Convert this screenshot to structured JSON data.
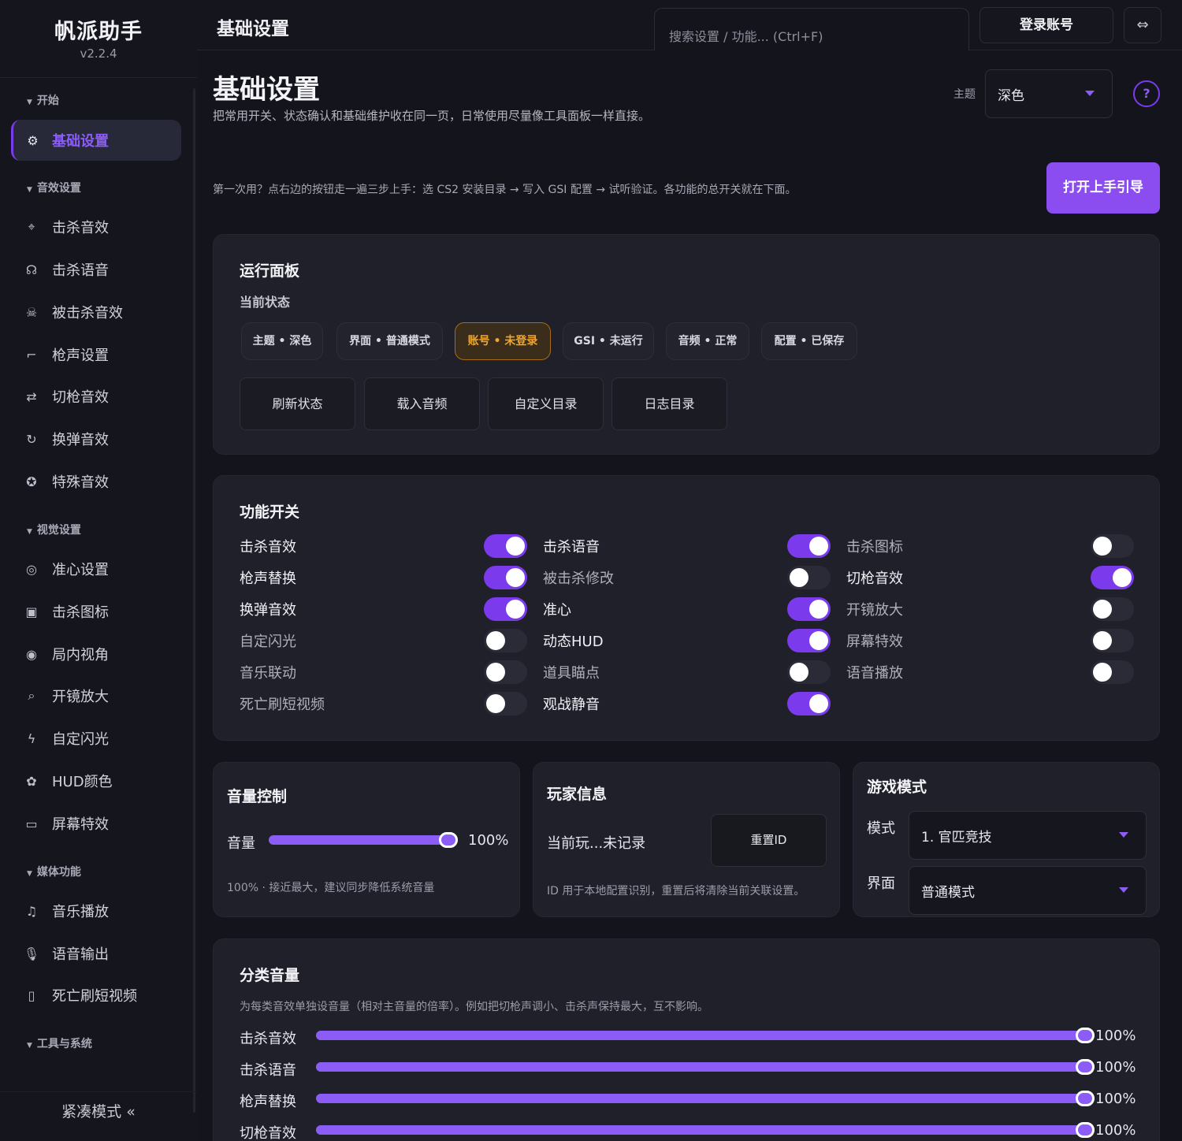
{
  "app": {
    "name": "帆派助手",
    "version": "v2.2.4"
  },
  "sidebar": {
    "sections": [
      {
        "label": "开始"
      },
      {
        "label": "音效设置"
      },
      {
        "label": "视觉设置"
      },
      {
        "label": "媒体功能"
      },
      {
        "label": "工具与系统"
      }
    ],
    "items": [
      {
        "label": "基础设置",
        "icon": "gear-icon"
      },
      {
        "label": "击杀音效",
        "icon": "crosshair-icon"
      },
      {
        "label": "击杀语音",
        "icon": "voice-icon"
      },
      {
        "label": "被击杀音效",
        "icon": "skull-icon"
      },
      {
        "label": "枪声设置",
        "icon": "gun-icon"
      },
      {
        "label": "切枪音效",
        "icon": "swap-icon"
      },
      {
        "label": "换弹音效",
        "icon": "reload-icon"
      },
      {
        "label": "特殊音效",
        "icon": "star-icon"
      },
      {
        "label": "准心设置",
        "icon": "target-icon"
      },
      {
        "label": "击杀图标",
        "icon": "image-icon"
      },
      {
        "label": "局内视角",
        "icon": "eye-icon"
      },
      {
        "label": "开镜放大",
        "icon": "zoom-icon"
      },
      {
        "label": "自定闪光",
        "icon": "flash-icon"
      },
      {
        "label": "HUD颜色",
        "icon": "palette-icon"
      },
      {
        "label": "屏幕特效",
        "icon": "monitor-icon"
      },
      {
        "label": "音乐播放",
        "icon": "music-icon"
      },
      {
        "label": "语音输出",
        "icon": "mic-icon"
      },
      {
        "label": "死亡刷短视频",
        "icon": "phone-icon"
      }
    ],
    "compact_label": "紧凑模式",
    "compact_icon": "«"
  },
  "topbar": {
    "title": "基础设置",
    "search_placeholder": "搜索设置 / 功能... (Ctrl+F)",
    "login_label": "登录账号",
    "swap_icon": "⇔"
  },
  "page": {
    "title": "基础设置",
    "subtitle": "把常用开关、状态确认和基础维护收在同一页，日常使用尽量像工具面板一样直接。",
    "theme_label": "主题",
    "theme_value": "深色",
    "help": "?",
    "guide_text": "第一次用？点右边的按钮走一遍三步上手：选 CS2 安装目录 → 写入 GSI 配置 → 试听验证。各功能的总开关就在下面。",
    "guide_button": "打开上手引导"
  },
  "run_panel": {
    "title": "运行面板",
    "status_title": "当前状态",
    "pills": [
      "主题 • 深色",
      "界面 • 普通模式",
      "账号 • 未登录",
      "GSI • 未运行",
      "音频 • 正常",
      "配置 • 已保存"
    ],
    "actions": [
      "刷新状态",
      "载入音频",
      "自定义目录",
      "日志目录"
    ],
    "accent_warn": "#f5a524"
  },
  "features": {
    "title": "功能开关",
    "accent": "#7c3aed",
    "toggles": [
      {
        "label": "击杀音效",
        "on": true
      },
      {
        "label": "击杀语音",
        "on": true
      },
      {
        "label": "击杀图标",
        "on": false
      },
      {
        "label": "枪声替换",
        "on": true
      },
      {
        "label": "被击杀修改",
        "on": false
      },
      {
        "label": "切枪音效",
        "on": true
      },
      {
        "label": "换弹音效",
        "on": true
      },
      {
        "label": "准心",
        "on": true
      },
      {
        "label": "开镜放大",
        "on": false
      },
      {
        "label": "自定闪光",
        "on": false
      },
      {
        "label": "动态HUD",
        "on": true
      },
      {
        "label": "屏幕特效",
        "on": false
      },
      {
        "label": "音乐联动",
        "on": false
      },
      {
        "label": "道具瞄点",
        "on": false
      },
      {
        "label": "语音播放",
        "on": false
      },
      {
        "label": "死亡刷短视频",
        "on": false
      },
      {
        "label": "观战静音",
        "on": true
      }
    ]
  },
  "volume": {
    "title": "音量控制",
    "label": "音量",
    "value_text": "100%",
    "value": 1.0,
    "hint": "100% · 接近最大，建议同步降低系统音量"
  },
  "player": {
    "title": "玩家信息",
    "current": "当前玩...未记录",
    "reset_button": "重置ID",
    "hint": "ID 用于本地配置识别，重置后将清除当前关联设置。"
  },
  "game_mode": {
    "title": "游戏模式",
    "mode_label": "模式",
    "mode_value": "1. 官匹竞技",
    "ui_label": "界面",
    "ui_value": "普通模式"
  },
  "category_volume": {
    "title": "分类音量",
    "hint": "为每类音效单独设音量（相对主音量的倍率）。例如把切枪声调小、击杀声保持最大，互不影响。",
    "rows": [
      {
        "label": "击杀音效",
        "value_text": "100%",
        "value": 1.0
      },
      {
        "label": "击杀语音",
        "value_text": "100%",
        "value": 1.0
      },
      {
        "label": "枪声替换",
        "value_text": "100%",
        "value": 1.0
      },
      {
        "label": "切枪音效",
        "value_text": "100%",
        "value": 1.0
      }
    ]
  }
}
